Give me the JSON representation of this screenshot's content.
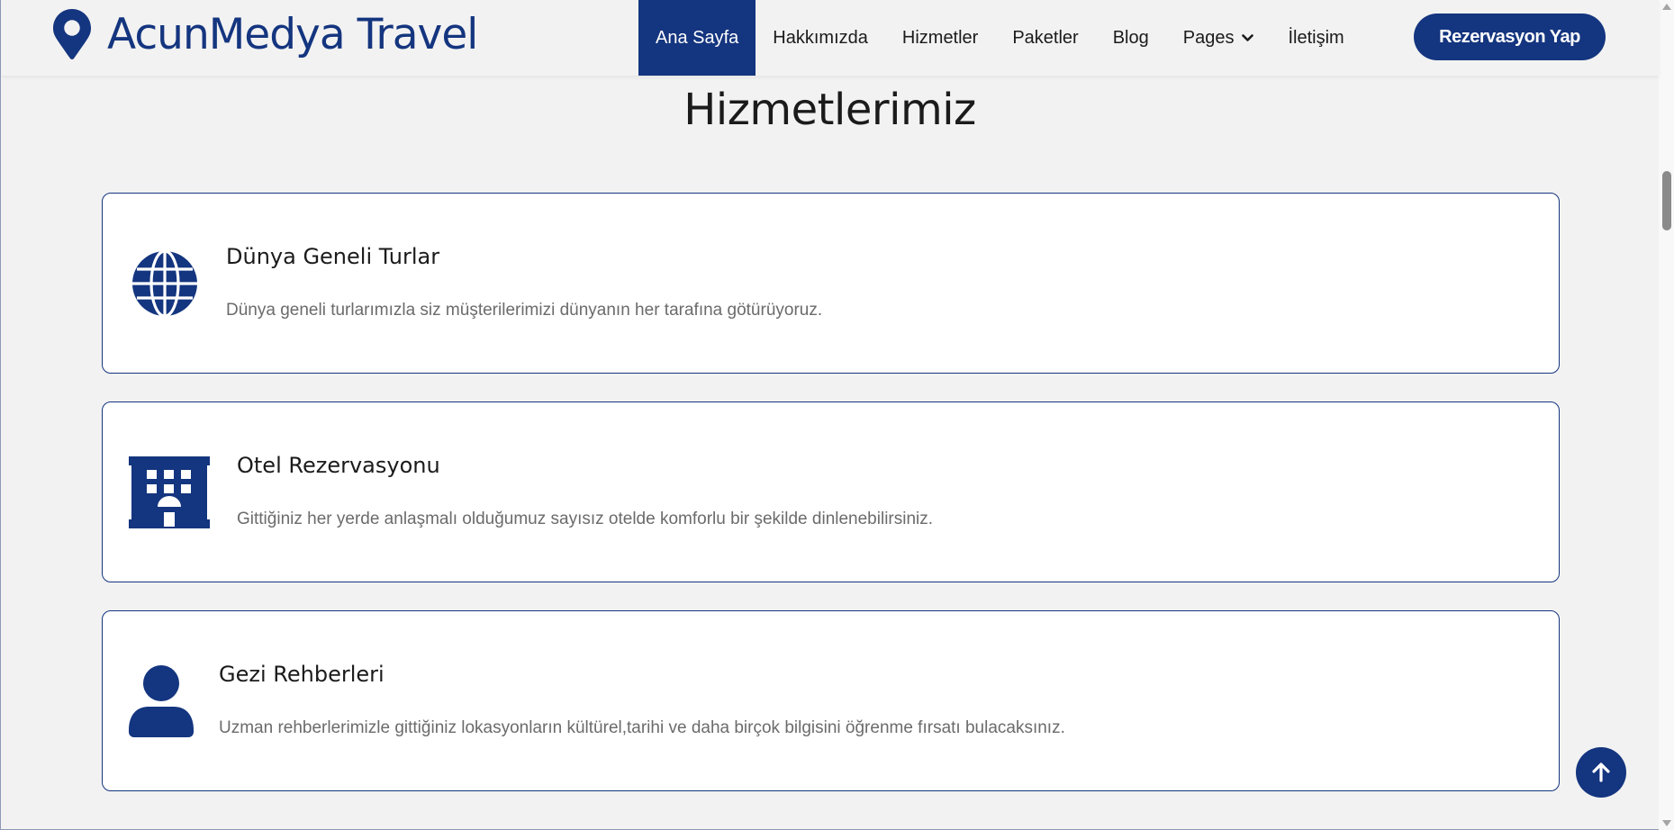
{
  "brand": {
    "name": "AcunMedya Travel",
    "icon": "map-pin-icon"
  },
  "nav": {
    "items": [
      {
        "label": "Ana Sayfa",
        "active": true
      },
      {
        "label": "Hakkımızda",
        "active": false
      },
      {
        "label": "Hizmetler",
        "active": false
      },
      {
        "label": "Paketler",
        "active": false
      },
      {
        "label": "Blog",
        "active": false
      },
      {
        "label": "Pages",
        "active": false,
        "dropdown": true
      },
      {
        "label": "İletişim",
        "active": false
      }
    ],
    "cta_label": "Rezervasyon Yap"
  },
  "services": {
    "title": "Hizmetlerimiz",
    "cards": [
      {
        "icon": "globe-icon",
        "title": "Dünya Geneli Turlar",
        "description": "Dünya geneli turlarımızla siz müşterilerimizi dünyanın her tarafına götürüyoruz."
      },
      {
        "icon": "hotel-icon",
        "title": "Otel Rezervasyonu",
        "description": "Gittiğiniz her yerde anlaşmalı olduğumuz sayısız otelde komforlu bir şekilde dinlenebilirsiniz."
      },
      {
        "icon": "user-icon",
        "title": "Gezi Rehberleri",
        "description": "Uzman rehberlerimizle gittiğiniz lokasyonların kültürel,tarihi ve daha birçok bilgisini öğrenme fırsatı bulacaksınız."
      }
    ]
  },
  "colors": {
    "primary": "#14357f",
    "background": "#f2f2f2",
    "muted_text": "#6b6b6b"
  },
  "back_to_top_icon": "arrow-up-icon"
}
